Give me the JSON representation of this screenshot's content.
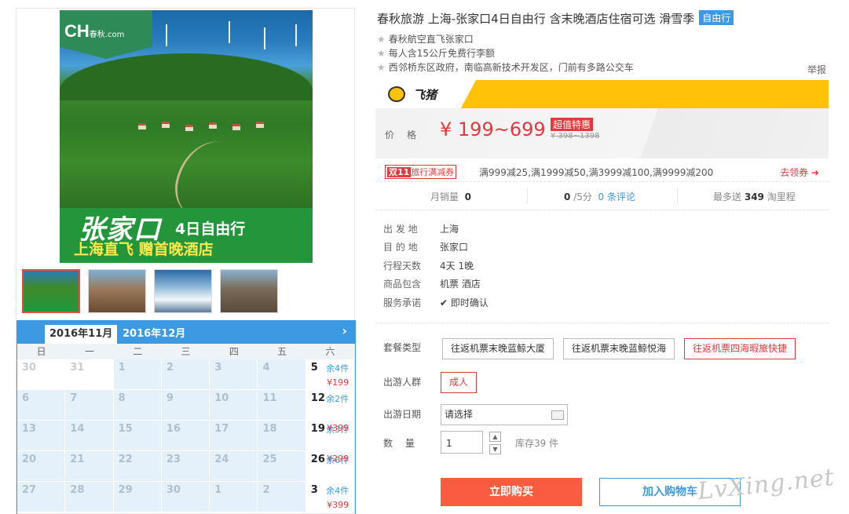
{
  "product": {
    "title": "春秋旅游 上海-张家口4日自由行 含末晚酒店住宿可选 滑雪季",
    "badge": "自由行",
    "features": [
      "春秋航空直飞张家口",
      "每人含15公斤免费行李额",
      "西邻桥东区政府，南临高新技术开发区，门前有多路公交车"
    ],
    "report": "举报"
  },
  "image": {
    "logo": "CH",
    "logo_brand": "春秋",
    "logo_domain": ".com",
    "headline": "张家口",
    "subhead": "4日自由行",
    "slogan": "上海直飞  赠首晚酒店"
  },
  "promo": {
    "platform": "飞猪"
  },
  "price": {
    "label": "价格",
    "value": "¥ 199~699",
    "deal": "超值特惠",
    "original": "¥ 398~1398"
  },
  "discount": {
    "badge_a": "双11",
    "badge_b": "旅行满减券",
    "text": "满999减25,满1999减50,满3999减100,满9999减200",
    "coupon": "去领券"
  },
  "stats": {
    "monthly_label": "月销量",
    "monthly_value": "0",
    "score": "0",
    "score_suffix": "/5分",
    "reviews": "0 条评论",
    "mileage_label": "最多送",
    "mileage_value": "349",
    "mileage_suffix": "淘里程"
  },
  "info": [
    {
      "k": "出 发 地",
      "v": "上海"
    },
    {
      "k": "目 的 地",
      "v": "张家口"
    },
    {
      "k": "行程天数",
      "v": "4天 1晚"
    },
    {
      "k": "商品包含",
      "v": "机票  酒店"
    },
    {
      "k": "服务承诺",
      "v": "即时确认"
    }
  ],
  "options": {
    "package_label": "套餐类型",
    "packages": [
      "往返机票末晚蓝鲸大厦",
      "往返机票末晚蓝鲸悦海",
      "往返机票四海暇旅快捷"
    ],
    "people_label": "出游人群",
    "people": "成人",
    "date_label": "出游日期",
    "date_placeholder": "请选择",
    "qty_label": "数  量",
    "qty_value": "1",
    "stock": "库存39 件"
  },
  "actions": {
    "buy": "立即购买",
    "cart": "加入购物车"
  },
  "calendar": {
    "tab_active": "2016年11月",
    "tab_other": "2016年12月",
    "weekdays": [
      "日",
      "一",
      "二",
      "三",
      "四",
      "五",
      "六"
    ],
    "cells": [
      {
        "d": "30",
        "t": "prev"
      },
      {
        "d": "31",
        "t": "prev"
      },
      {
        "d": "1"
      },
      {
        "d": "2"
      },
      {
        "d": "3"
      },
      {
        "d": "4"
      },
      {
        "d": "5",
        "t": "avail",
        "stock": "余4件",
        "price": "¥199"
      },
      {
        "d": "6"
      },
      {
        "d": "7"
      },
      {
        "d": "8"
      },
      {
        "d": "9"
      },
      {
        "d": "10"
      },
      {
        "d": "11"
      },
      {
        "d": "12",
        "t": "avail",
        "stock": "余2件",
        "price": ""
      },
      {
        "d": "13"
      },
      {
        "d": "14"
      },
      {
        "d": "15"
      },
      {
        "d": "16"
      },
      {
        "d": "17"
      },
      {
        "d": "18"
      },
      {
        "d": "19",
        "t": "avail",
        "stock": "",
        "price": "¥399",
        "stock2": "余3件"
      },
      {
        "d": "20"
      },
      {
        "d": "21"
      },
      {
        "d": "22"
      },
      {
        "d": "23"
      },
      {
        "d": "24"
      },
      {
        "d": "25"
      },
      {
        "d": "26",
        "t": "avail",
        "stock": "",
        "price": "¥299",
        "stock2": "余6件"
      },
      {
        "d": "27"
      },
      {
        "d": "28"
      },
      {
        "d": "29"
      },
      {
        "d": "30"
      },
      {
        "d": "1",
        "t": "next"
      },
      {
        "d": "2",
        "t": "next"
      },
      {
        "d": "3",
        "t": "avail",
        "stock": "余4件",
        "price": "¥399"
      }
    ]
  },
  "watermark": "LvXing.net",
  "colors": {
    "accent": "#3d9ae2",
    "price": "#e4393c",
    "buy": "#f95c3e",
    "promo": "#ffc208"
  }
}
